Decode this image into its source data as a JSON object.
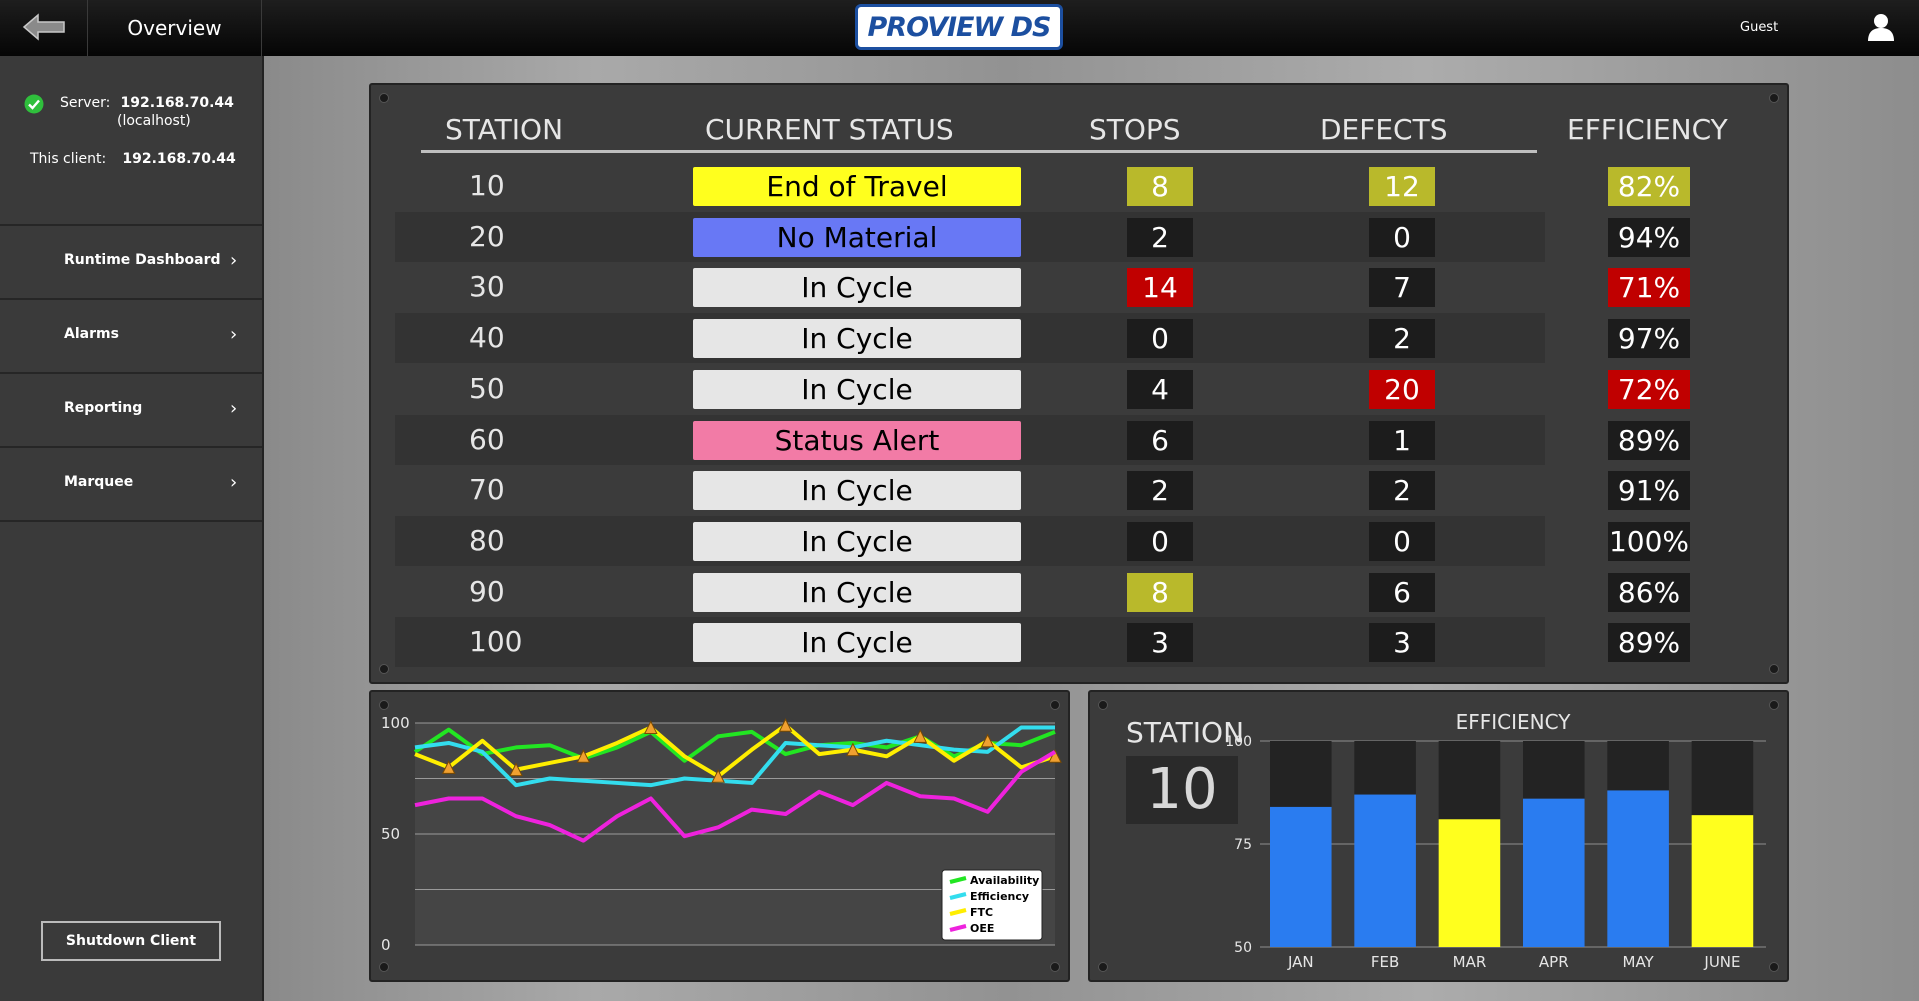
{
  "header": {
    "title": "Overview",
    "logo_text": "PROVIEW DS",
    "user": "Guest"
  },
  "sidebar": {
    "server_label": "Server:",
    "server_ip": "192.168.70.44",
    "server_host": "(localhost)",
    "client_label": "This client:",
    "client_ip": "192.168.70.44",
    "items": [
      {
        "label": "Runtime Dashboard"
      },
      {
        "label": "Alarms"
      },
      {
        "label": "Reporting"
      },
      {
        "label": "Marquee"
      }
    ],
    "shutdown_label": "Shutdown Client"
  },
  "table": {
    "headers": [
      "STATION",
      "CURRENT STATUS",
      "STOPS",
      "DEFECTS",
      "EFFICIENCY"
    ],
    "rows": [
      {
        "station": "10",
        "status": "End of Travel",
        "status_color": "#ffff1e",
        "stops": "8",
        "stops_flag": "yellow",
        "defects": "12",
        "defects_flag": "yellow",
        "efficiency": "82%",
        "eff_flag": "yellow"
      },
      {
        "station": "20",
        "status": "No Material",
        "status_color": "#6878f5",
        "stops": "2",
        "stops_flag": "",
        "defects": "0",
        "defects_flag": "",
        "efficiency": "94%",
        "eff_flag": ""
      },
      {
        "station": "30",
        "status": "In Cycle",
        "status_color": "#e6e6e6",
        "stops": "14",
        "stops_flag": "red",
        "defects": "7",
        "defects_flag": "",
        "efficiency": "71%",
        "eff_flag": "red"
      },
      {
        "station": "40",
        "status": "In Cycle",
        "status_color": "#e6e6e6",
        "stops": "0",
        "stops_flag": "",
        "defects": "2",
        "defects_flag": "",
        "efficiency": "97%",
        "eff_flag": ""
      },
      {
        "station": "50",
        "status": "In Cycle",
        "status_color": "#e6e6e6",
        "stops": "4",
        "stops_flag": "",
        "defects": "20",
        "defects_flag": "red",
        "efficiency": "72%",
        "eff_flag": "red"
      },
      {
        "station": "60",
        "status": "Status Alert",
        "status_color": "#f27ba6",
        "stops": "6",
        "stops_flag": "",
        "defects": "1",
        "defects_flag": "",
        "efficiency": "89%",
        "eff_flag": ""
      },
      {
        "station": "70",
        "status": "In Cycle",
        "status_color": "#e6e6e6",
        "stops": "2",
        "stops_flag": "",
        "defects": "2",
        "defects_flag": "",
        "efficiency": "91%",
        "eff_flag": ""
      },
      {
        "station": "80",
        "status": "In Cycle",
        "status_color": "#e6e6e6",
        "stops": "0",
        "stops_flag": "",
        "defects": "0",
        "defects_flag": "",
        "efficiency": "100%",
        "eff_flag": ""
      },
      {
        "station": "90",
        "status": "In Cycle",
        "status_color": "#e6e6e6",
        "stops": "8",
        "stops_flag": "yellow",
        "defects": "6",
        "defects_flag": "",
        "efficiency": "86%",
        "eff_flag": ""
      },
      {
        "station": "100",
        "status": "In Cycle",
        "status_color": "#e6e6e6",
        "stops": "3",
        "stops_flag": "",
        "defects": "3",
        "defects_flag": "",
        "efficiency": "89%",
        "eff_flag": ""
      }
    ]
  },
  "station_panel": {
    "label": "STATION",
    "value": "10"
  },
  "chart_data": [
    {
      "type": "line",
      "ylim": [
        0,
        100
      ],
      "yticks": [
        "100",
        "50",
        "0"
      ],
      "grid": true,
      "legend_position": "bottom-right",
      "series": [
        {
          "name": "Availability",
          "color": "#22e622",
          "values": [
            87,
            97,
            86,
            89,
            90,
            84,
            89,
            96,
            83,
            94,
            96,
            86,
            90,
            91,
            89,
            94,
            85,
            91,
            90,
            96
          ]
        },
        {
          "name": "Efficiency",
          "color": "#33ddee",
          "values": [
            89,
            91,
            87,
            72,
            75,
            74,
            73,
            72,
            75,
            74,
            73,
            91,
            90,
            89,
            92,
            90,
            88,
            87,
            98,
            98
          ]
        },
        {
          "name": "FTC",
          "color": "#ffee00",
          "values": [
            86,
            80,
            92,
            79,
            82,
            85,
            91,
            98,
            85,
            76,
            88,
            99,
            86,
            88,
            85,
            94,
            83,
            92,
            80,
            85
          ]
        },
        {
          "name": "OEE",
          "color": "#ee22dd",
          "values": [
            63,
            66,
            66,
            58,
            54,
            47,
            58,
            66,
            49,
            53,
            61,
            59,
            69,
            63,
            73,
            67,
            66,
            60,
            78,
            87
          ]
        }
      ],
      "markers_on": "FTC"
    },
    {
      "type": "bar",
      "title": "EFFICIENCY",
      "categories": [
        "JAN",
        "FEB",
        "MAR",
        "APR",
        "MAY",
        "JUNE"
      ],
      "values": [
        84,
        87,
        81,
        86,
        88,
        82
      ],
      "bar_colors": [
        "#2a7cf0",
        "#2a7cf0",
        "#ffff1e",
        "#2a7cf0",
        "#2a7cf0",
        "#ffff1e"
      ],
      "ylim": [
        50,
        100
      ],
      "yticks": [
        "100",
        "75",
        "50"
      ]
    }
  ]
}
